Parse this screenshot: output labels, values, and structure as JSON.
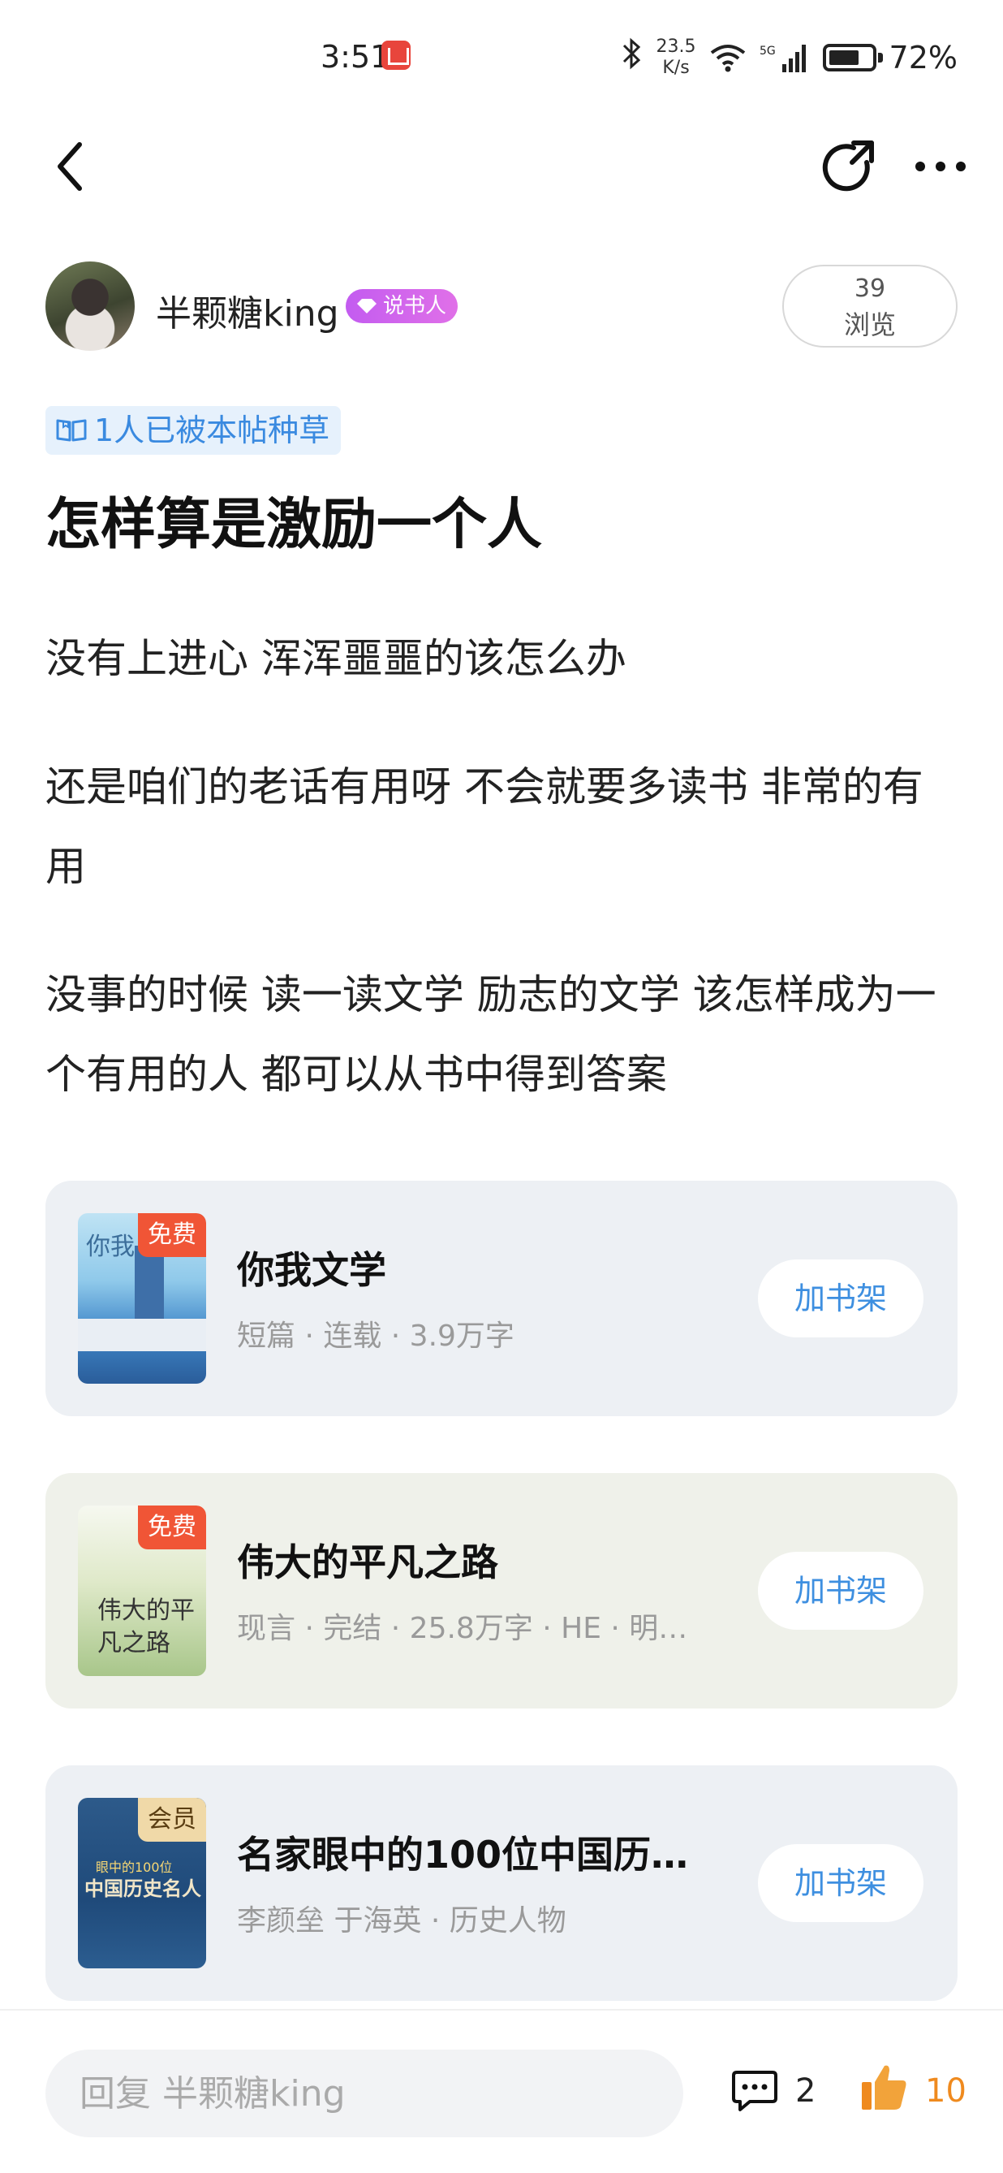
{
  "status_bar": {
    "time": "3:51",
    "net_speed_value": "23.5",
    "net_speed_unit": "K/s",
    "battery": "72%",
    "icons": [
      "app-notification-icon",
      "bluetooth-icon",
      "wifi-icon",
      "5g-signal-icon",
      "battery-icon"
    ]
  },
  "nav": {
    "back_icon": "chevron-left-icon",
    "refresh_icon": "refresh-icon",
    "more_icon": "more-dots-icon"
  },
  "author": {
    "name": "半颗糖king",
    "badge": "说书人",
    "views_count": "39",
    "views_label": "浏览"
  },
  "post": {
    "seed_tag": "1人已被本帖种草",
    "title": "怎样算是激励一个人",
    "paragraphs": [
      "没有上进心  浑浑噩噩的该怎么办",
      "还是咱们的老话有用呀  不会就要多读书  非常的有用",
      "没事的时候 读一读文学 励志的文学  该怎样成为一个有用的人 都可以从书中得到答案"
    ]
  },
  "books": [
    {
      "tag": "免费",
      "cover_text": "你我",
      "title": "你我文学",
      "meta": "短篇 · 连载 · 3.9万字",
      "button": "加书架"
    },
    {
      "tag": "免费",
      "cover_text": "伟大的平凡之路",
      "title": "伟大的平凡之路",
      "meta": "现言 · 完结 · 25.8万字 · HE · 明…",
      "button": "加书架"
    },
    {
      "tag": "会员",
      "cover_text": "中国历史名人",
      "cover_sub": "眼中的100位",
      "title": "名家眼中的100位中国历史…",
      "meta": "李颜垒 于海英 · 历史人物",
      "button": "加书架"
    }
  ],
  "bottom_bar": {
    "reply_placeholder": "回复 半颗糖king",
    "comment_count": "2",
    "like_count": "10",
    "like_color": "#ef8a1e"
  },
  "colors": {
    "accent_blue": "#3e8fe0",
    "badge_purple": "#c35cf0",
    "free_tag": "#f05536",
    "vip_tag": "#f0d9a8"
  }
}
